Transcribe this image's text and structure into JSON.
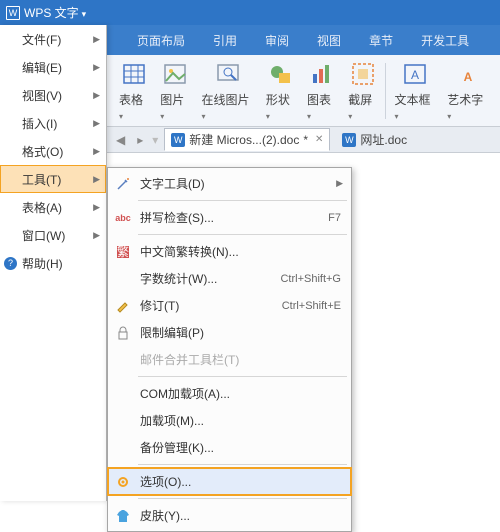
{
  "titlebar": {
    "app_name": "WPS 文字"
  },
  "filemenu": [
    {
      "label": "文件(F)",
      "arrow": true
    },
    {
      "label": "编辑(E)",
      "arrow": true
    },
    {
      "label": "视图(V)",
      "arrow": true
    },
    {
      "label": "插入(I)",
      "arrow": true
    },
    {
      "label": "格式(O)",
      "arrow": true
    },
    {
      "label": "工具(T)",
      "arrow": true,
      "hover": true
    },
    {
      "label": "表格(A)",
      "arrow": true
    },
    {
      "label": "窗口(W)",
      "arrow": true
    },
    {
      "label": "帮助(H)",
      "arrow": false,
      "help": true
    }
  ],
  "tabs": [
    "页面布局",
    "引用",
    "审阅",
    "视图",
    "章节",
    "开发工具"
  ],
  "ribbon": [
    {
      "name": "table",
      "label": "表格"
    },
    {
      "name": "picture",
      "label": "图片"
    },
    {
      "name": "online",
      "label": "在线图片"
    },
    {
      "name": "shape",
      "label": "形状"
    },
    {
      "name": "chart",
      "label": "图表"
    },
    {
      "name": "screenshot",
      "label": "截屏"
    },
    {
      "sep": true
    },
    {
      "name": "textbox",
      "label": "文本框"
    },
    {
      "name": "wordart",
      "label": "艺术字"
    }
  ],
  "doctabs": {
    "active": {
      "label": "新建 Micros...(2).doc",
      "dirty": "*"
    },
    "other": {
      "label": "网址.doc"
    }
  },
  "submenu": [
    {
      "label": "文字工具(D)",
      "icon": "wand",
      "arrow": true
    },
    {
      "sep": true
    },
    {
      "label": "拼写检查(S)...",
      "icon": "abc",
      "shortcut": "F7"
    },
    {
      "sep": true
    },
    {
      "label": "中文简繁转换(N)...",
      "icon": "convert"
    },
    {
      "label": "字数统计(W)...",
      "shortcut": "Ctrl+Shift+G"
    },
    {
      "label": "修订(T)",
      "icon": "revise",
      "shortcut": "Ctrl+Shift+E"
    },
    {
      "label": "限制编辑(P)",
      "icon": "lock"
    },
    {
      "label": "邮件合并工具栏(T)",
      "disabled": true
    },
    {
      "sep": true
    },
    {
      "label": "COM加载项(A)..."
    },
    {
      "label": "加载项(M)..."
    },
    {
      "label": "备份管理(K)..."
    },
    {
      "sep": true
    },
    {
      "label": "选项(O)...",
      "icon": "gear",
      "boxed": true
    },
    {
      "sep": true
    },
    {
      "label": "皮肤(Y)...",
      "icon": "shirt"
    }
  ],
  "colors": {
    "accent": "#2e75c6",
    "highlight_border": "#f4a322",
    "highlight_fill": "#fde1b7",
    "wordart": "#e7833b"
  }
}
